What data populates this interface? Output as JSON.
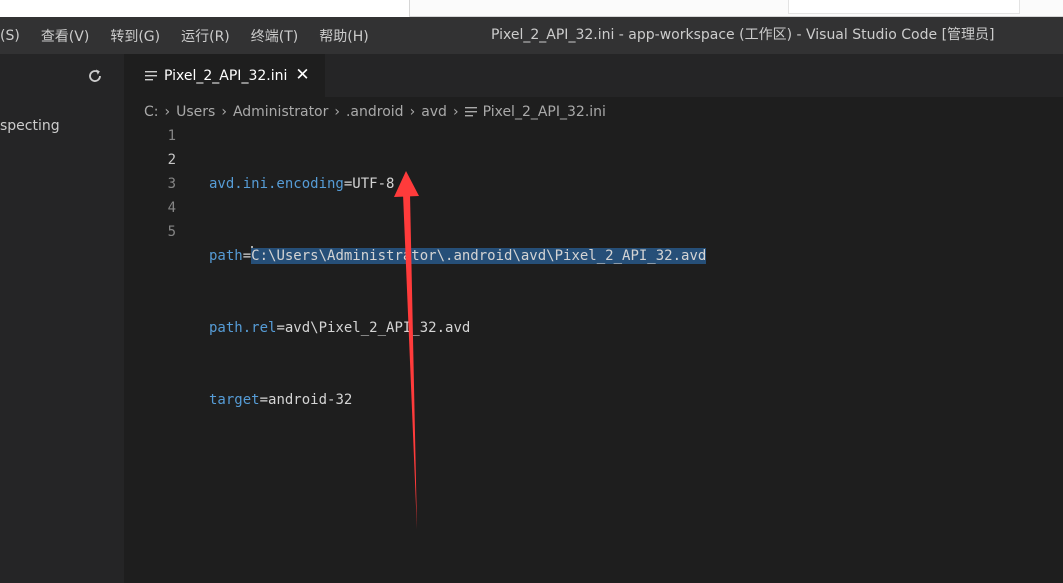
{
  "menu": {
    "items": [
      "(S)",
      "查看(V)",
      "转到(G)",
      "运行(R)",
      "终端(T)",
      "帮助(H)"
    ]
  },
  "window": {
    "title": "Pixel_2_API_32.ini - app-workspace (工作区) - Visual Studio Code [管理员]"
  },
  "sidebar": {
    "refresh_icon": "refresh-icon",
    "text": "specting"
  },
  "tab": {
    "label": "Pixel_2_API_32.ini",
    "close": "✕",
    "icon": "lines-icon"
  },
  "breadcrumb": {
    "items": [
      "C:",
      "Users",
      "Administrator",
      ".android",
      "avd"
    ],
    "file": "Pixel_2_API_32.ini",
    "separator": "›"
  },
  "editor": {
    "line_numbers": [
      "1",
      "2",
      "3",
      "4",
      "5"
    ],
    "lines": [
      {
        "key": "avd.ini.encoding",
        "eq": "=",
        "value": "UTF-8"
      },
      {
        "key": "path",
        "eq": "=",
        "value": "C:\\Users\\Administrator\\.android\\avd\\Pixel_2_API_32.avd"
      },
      {
        "key": "path.rel",
        "eq": "=",
        "value": "avd\\Pixel_2_API_32.avd"
      },
      {
        "key": "target",
        "eq": "=",
        "value": "android-32"
      }
    ],
    "selected_line": 2
  },
  "colors": {
    "background": "#1e1e1e",
    "sidebar": "#252526",
    "titlebar": "#323233",
    "keyword": "#569cd6",
    "selection": "#264f78",
    "annotation_arrow": "#ff3b3b"
  }
}
